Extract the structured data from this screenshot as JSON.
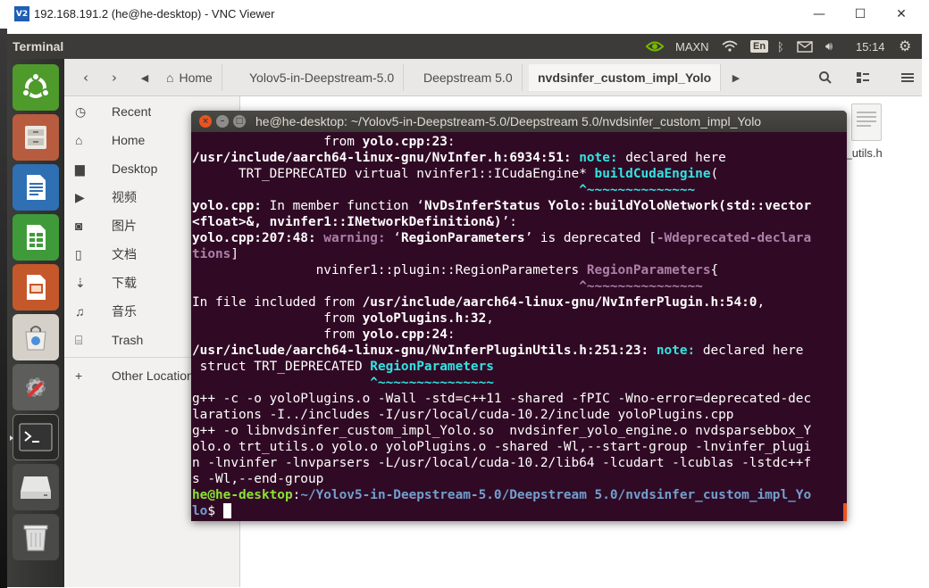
{
  "vnc": {
    "logo": "V2",
    "title": "192.168.191.2 (he@he-desktop) - VNC Viewer",
    "minimize": "—",
    "maximize": "☐",
    "close": "✕"
  },
  "panel": {
    "app_name": "Terminal",
    "tray": {
      "nvidia_icon": "nvidia-icon",
      "maxn": "MAXN",
      "lang": "En",
      "time": "15:14"
    }
  },
  "launcher": {
    "items": [
      "ubuntu-dash",
      "files",
      "libreoffice-writer",
      "libreoffice-calc",
      "libreoffice-impress",
      "software-center",
      "system-settings",
      "terminal",
      "removable-drive",
      "trash"
    ]
  },
  "nautilus": {
    "breadcrumbs": [
      "Home",
      "Yolov5-in-Deepstream-5.0",
      "Deepstream 5.0",
      "nvdsinfer_custom_impl_Yolo"
    ],
    "sidebar": [
      {
        "icon": "recent-icon",
        "label": "Recent"
      },
      {
        "icon": "home-icon",
        "label": "Home"
      },
      {
        "icon": "folder-icon",
        "label": "Desktop"
      },
      {
        "icon": "video-icon",
        "label": "视频"
      },
      {
        "icon": "camera-icon",
        "label": "图片"
      },
      {
        "icon": "document-icon",
        "label": "文档"
      },
      {
        "icon": "download-icon",
        "label": "下载"
      },
      {
        "icon": "music-icon",
        "label": "音乐"
      },
      {
        "icon": "trash-icon",
        "label": "Trash"
      },
      {
        "icon": "plus-icon",
        "label": "Other Locations"
      }
    ],
    "files": [
      {
        "label": "trt_utils.h"
      }
    ],
    "colors": {
      "terminal_bg": "#300a24",
      "panel_bg": "#3c3b37"
    }
  },
  "terminal": {
    "title": "he@he-desktop: ~/Yolov5-in-Deepstream-5.0/Deepstream 5.0/nvdsinfer_custom_impl_Yolo",
    "lines": [
      [
        {
          "t": "                 from "
        },
        {
          "t": "yolo.cpp:23",
          "c": "b"
        },
        {
          "t": ":"
        }
      ],
      [
        {
          "t": "/usr/include/aarch64-linux-gnu/NvInfer.h:6934:51:",
          "c": "b"
        },
        {
          "t": " "
        },
        {
          "t": "note:",
          "c": "cyan"
        },
        {
          "t": " declared here"
        }
      ],
      [
        {
          "t": "      TRT_DEPRECATED virtual nvinfer1::ICudaEngine* "
        },
        {
          "t": "buildCudaEngine",
          "c": "cyan"
        },
        {
          "t": "("
        }
      ],
      [
        {
          "t": "                                                  "
        },
        {
          "t": "^~~~~~~~~~~~~~~",
          "c": "cyan"
        }
      ],
      [
        {
          "t": "yolo.cpp:",
          "c": "b"
        },
        {
          "t": " In member function ‘"
        },
        {
          "t": "NvDsInferStatus Yolo::buildYoloNetwork(std::vector",
          "c": "b"
        }
      ],
      [
        {
          "t": "<float>&, nvinfer1::INetworkDefinition&)",
          "c": "b"
        },
        {
          "t": "’:"
        }
      ],
      [
        {
          "t": "yolo.cpp:207:48:",
          "c": "b"
        },
        {
          "t": " "
        },
        {
          "t": "warning:",
          "c": "mag"
        },
        {
          "t": " ‘"
        },
        {
          "t": "RegionParameters",
          "c": "b"
        },
        {
          "t": "’ is deprecated ["
        },
        {
          "t": "-Wdeprecated-declara",
          "c": "mag"
        }
      ],
      [
        {
          "t": "tions",
          "c": "mag"
        },
        {
          "t": "]"
        }
      ],
      [
        {
          "t": "                nvinfer1::plugin::RegionParameters "
        },
        {
          "t": "RegionParameters",
          "c": "mag"
        },
        {
          "t": "{"
        }
      ],
      [
        {
          "t": "                                                  "
        },
        {
          "t": "^~~~~~~~~~~~~~~~",
          "c": "mag"
        }
      ],
      [
        {
          "t": "In file included from "
        },
        {
          "t": "/usr/include/aarch64-linux-gnu/NvInferPlugin.h:54:0",
          "c": "b"
        },
        {
          "t": ","
        }
      ],
      [
        {
          "t": "                 from "
        },
        {
          "t": "yoloPlugins.h:32",
          "c": "b"
        },
        {
          "t": ","
        }
      ],
      [
        {
          "t": "                 from "
        },
        {
          "t": "yolo.cpp:24",
          "c": "b"
        },
        {
          "t": ":"
        }
      ],
      [
        {
          "t": "/usr/include/aarch64-linux-gnu/NvInferPluginUtils.h:251:23:",
          "c": "b"
        },
        {
          "t": " "
        },
        {
          "t": "note:",
          "c": "cyan"
        },
        {
          "t": " declared here"
        }
      ],
      [
        {
          "t": " struct TRT_DEPRECATED "
        },
        {
          "t": "RegionParameters",
          "c": "cyan"
        }
      ],
      [
        {
          "t": "                       "
        },
        {
          "t": "^~~~~~~~~~~~~~~~",
          "c": "cyan"
        }
      ],
      [
        {
          "t": "g++ -c -o yoloPlugins.o -Wall -std=c++11 -shared -fPIC -Wno-error=deprecated-dec"
        }
      ],
      [
        {
          "t": "larations -I../includes -I/usr/local/cuda-10.2/include yoloPlugins.cpp"
        }
      ],
      [
        {
          "t": "g++ -o libnvdsinfer_custom_impl_Yolo.so  nvdsinfer_yolo_engine.o nvdsparsebbox_Y"
        }
      ],
      [
        {
          "t": "olo.o trt_utils.o yolo.o yoloPlugins.o -shared -Wl,--start-group -lnvinfer_plugi"
        }
      ],
      [
        {
          "t": "n -lnvinfer -lnvparsers -L/usr/local/cuda-10.2/lib64 -lcudart -lcublas -lstdc++f"
        }
      ],
      [
        {
          "t": "s -Wl,--end-group"
        }
      ],
      [
        {
          "t": "he@he-desktop",
          "c": "grn"
        },
        {
          "t": ":"
        },
        {
          "t": "~/Yolov5-in-Deepstream-5.0/Deepstream 5.0/nvdsinfer_custom_impl_Yo",
          "c": "blu"
        }
      ],
      [
        {
          "t": "lo",
          "c": "blu"
        },
        {
          "t": "$ "
        },
        {
          "t": "",
          "c": "cursor"
        }
      ]
    ]
  }
}
